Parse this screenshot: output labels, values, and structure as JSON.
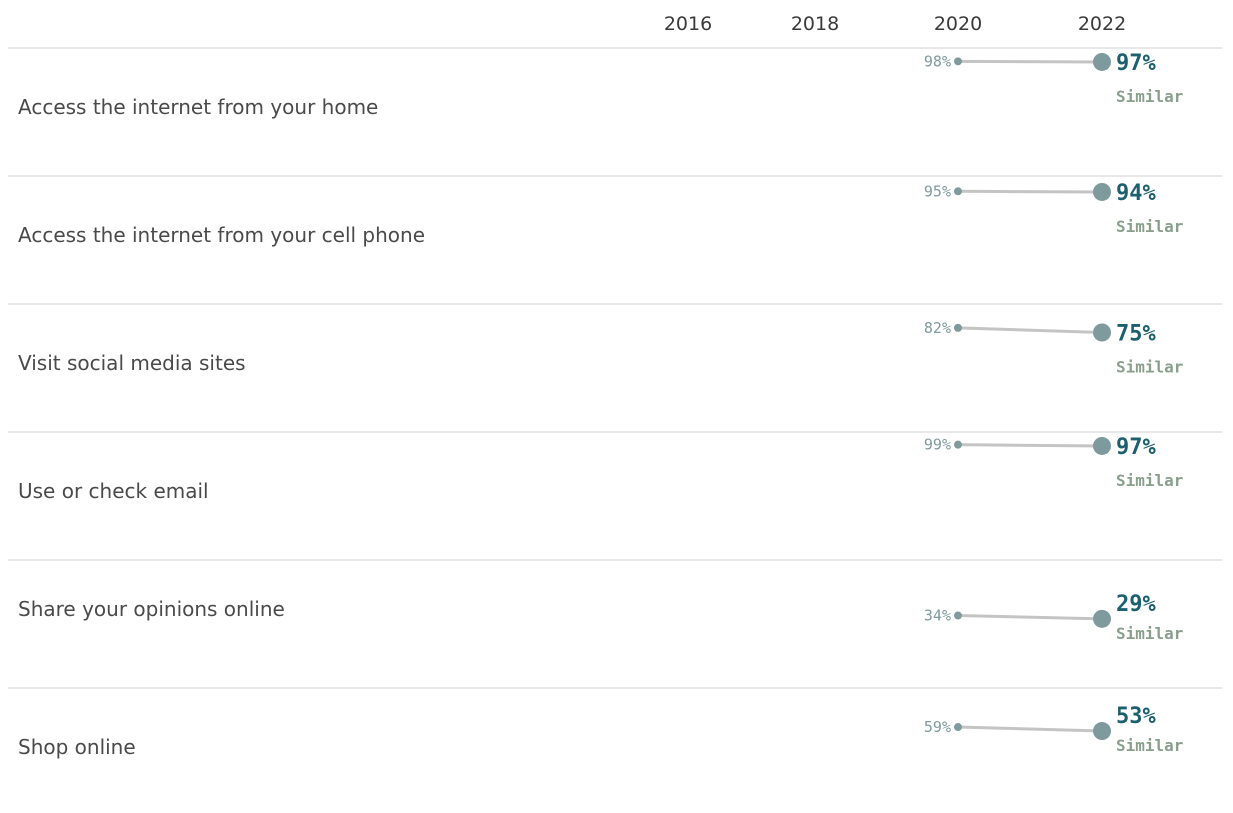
{
  "chart_data": {
    "type": "line",
    "x": [
      "2016",
      "2018",
      "2020",
      "2022"
    ],
    "categories": [
      "Access the internet from your home",
      "Access the internet from your cell phone",
      "Visit social media sites",
      "Use or check email",
      "Share your opinions online",
      "Shop online"
    ],
    "series": [
      {
        "category": "Access the internet from your home",
        "start_year": "2020",
        "end_year": "2022",
        "values": [
          98,
          97
        ],
        "start_label": "98%",
        "end_label": "97%",
        "status": "Similar"
      },
      {
        "category": "Access the internet from your cell phone",
        "start_year": "2020",
        "end_year": "2022",
        "values": [
          95,
          94
        ],
        "start_label": "95%",
        "end_label": "94%",
        "status": "Similar"
      },
      {
        "category": "Visit social media sites",
        "start_year": "2020",
        "end_year": "2022",
        "values": [
          82,
          75
        ],
        "start_label": "82%",
        "end_label": "75%",
        "status": "Similar"
      },
      {
        "category": "Use or check email",
        "start_year": "2020",
        "end_year": "2022",
        "values": [
          99,
          97
        ],
        "start_label": "99%",
        "end_label": "97%",
        "status": "Similar"
      },
      {
        "category": "Share your opinions online",
        "start_year": "2020",
        "end_year": "2022",
        "values": [
          34,
          29
        ],
        "start_label": "34%",
        "end_label": "29%",
        "status": "Similar"
      },
      {
        "category": "Shop online",
        "start_year": "2020",
        "end_year": "2022",
        "values": [
          59,
          53
        ],
        "start_label": "59%",
        "end_label": "53%",
        "status": "Similar"
      }
    ],
    "ylim": [
      0,
      100
    ],
    "grid": false,
    "legend": "none"
  },
  "colors": {
    "dot": "#7f9a9d",
    "line": "#c4c4c4",
    "value_accent": "#1c5f6e",
    "status": "#8a9e8c",
    "divider": "#d9d9d9"
  }
}
